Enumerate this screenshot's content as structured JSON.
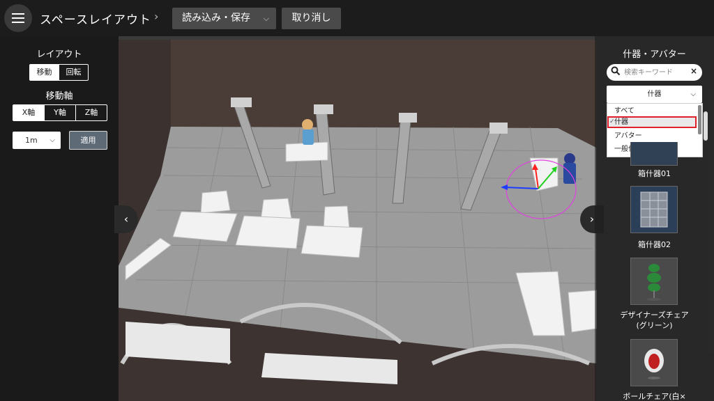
{
  "header": {
    "title": "スペースレイアウト",
    "breadcrumb_sep": "›",
    "load_save_label": "読み込み・保存",
    "undo_label": "取り消し"
  },
  "left_panel": {
    "layout_heading": "レイアウト",
    "mode_buttons": [
      "移動",
      "回転"
    ],
    "active_mode": "移動",
    "axis_heading": "移動軸",
    "axis_buttons": [
      "X軸",
      "Y軸",
      "Z軸"
    ],
    "active_axis": "X軸",
    "step_value": "1m",
    "apply_label": "適用"
  },
  "right_panel": {
    "title": "什器・アバター",
    "search_placeholder": "検索キーワード",
    "clear_symbol": "×",
    "category_value": "什器",
    "dropdown_options": [
      "すべて",
      "什器",
      "アバター",
      "一般什器"
    ],
    "selected_option": "什器",
    "items": [
      {
        "label": "箱什器01"
      },
      {
        "label": "箱什器02"
      },
      {
        "label": "デザイナーズチェア(グリーン)",
        "line1": "デザイナーズチェア",
        "line2": "(グリーン)"
      },
      {
        "label": "ボールチェア(白×",
        "line1": "ボールチェア(白×"
      }
    ]
  },
  "nav": {
    "prev_symbol": "‹",
    "next_symbol": "›"
  },
  "colors": {
    "accent_selection": "#e0202a",
    "gizmo_x": "#1e3cff",
    "gizmo_y": "#ff2020",
    "gizmo_z": "#20d020",
    "gizmo_ring": "#e040e0"
  }
}
